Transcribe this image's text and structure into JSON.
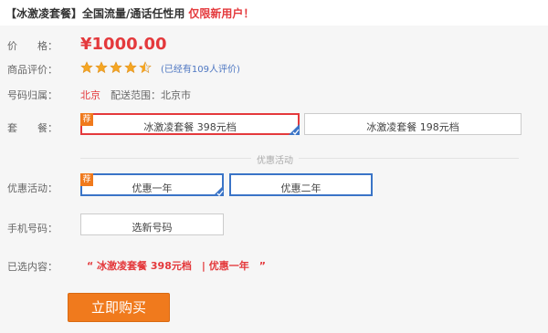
{
  "header": {
    "title": "【冰激凌套餐】全国流量/通话任性用",
    "promo": "仅限新用户！"
  },
  "price": {
    "label": "价　　格：",
    "value": "¥1000.00"
  },
  "rating": {
    "label": "商品评价：",
    "stars": 4.5,
    "count_text": "(已经有109人评价)"
  },
  "location": {
    "label": "号码归属：",
    "city": "北京",
    "delivery": "配送范围：北京市"
  },
  "package": {
    "label": "套　　餐：",
    "options": [
      {
        "label": "冰激凌套餐 398元档",
        "tag": "荐",
        "selected": true
      },
      {
        "label": "冰激凌套餐 198元档",
        "selected": false
      }
    ]
  },
  "promo_divider": "优惠活动",
  "discount": {
    "label": "优惠活动：",
    "options": [
      {
        "label": "优惠一年",
        "tag": "荐",
        "selected": true
      },
      {
        "label": "优惠二年",
        "selected": false
      }
    ]
  },
  "phone": {
    "label": "手机号码：",
    "button": "选新号码"
  },
  "selected": {
    "label": "已选内容：",
    "value": "“ 冰激凌套餐 398元档　| 优惠一年　”"
  },
  "buy_button": "立即购买",
  "colors": {
    "accent": "#e4393c",
    "orange": "#f07a1d",
    "blue": "#3a74c7"
  }
}
